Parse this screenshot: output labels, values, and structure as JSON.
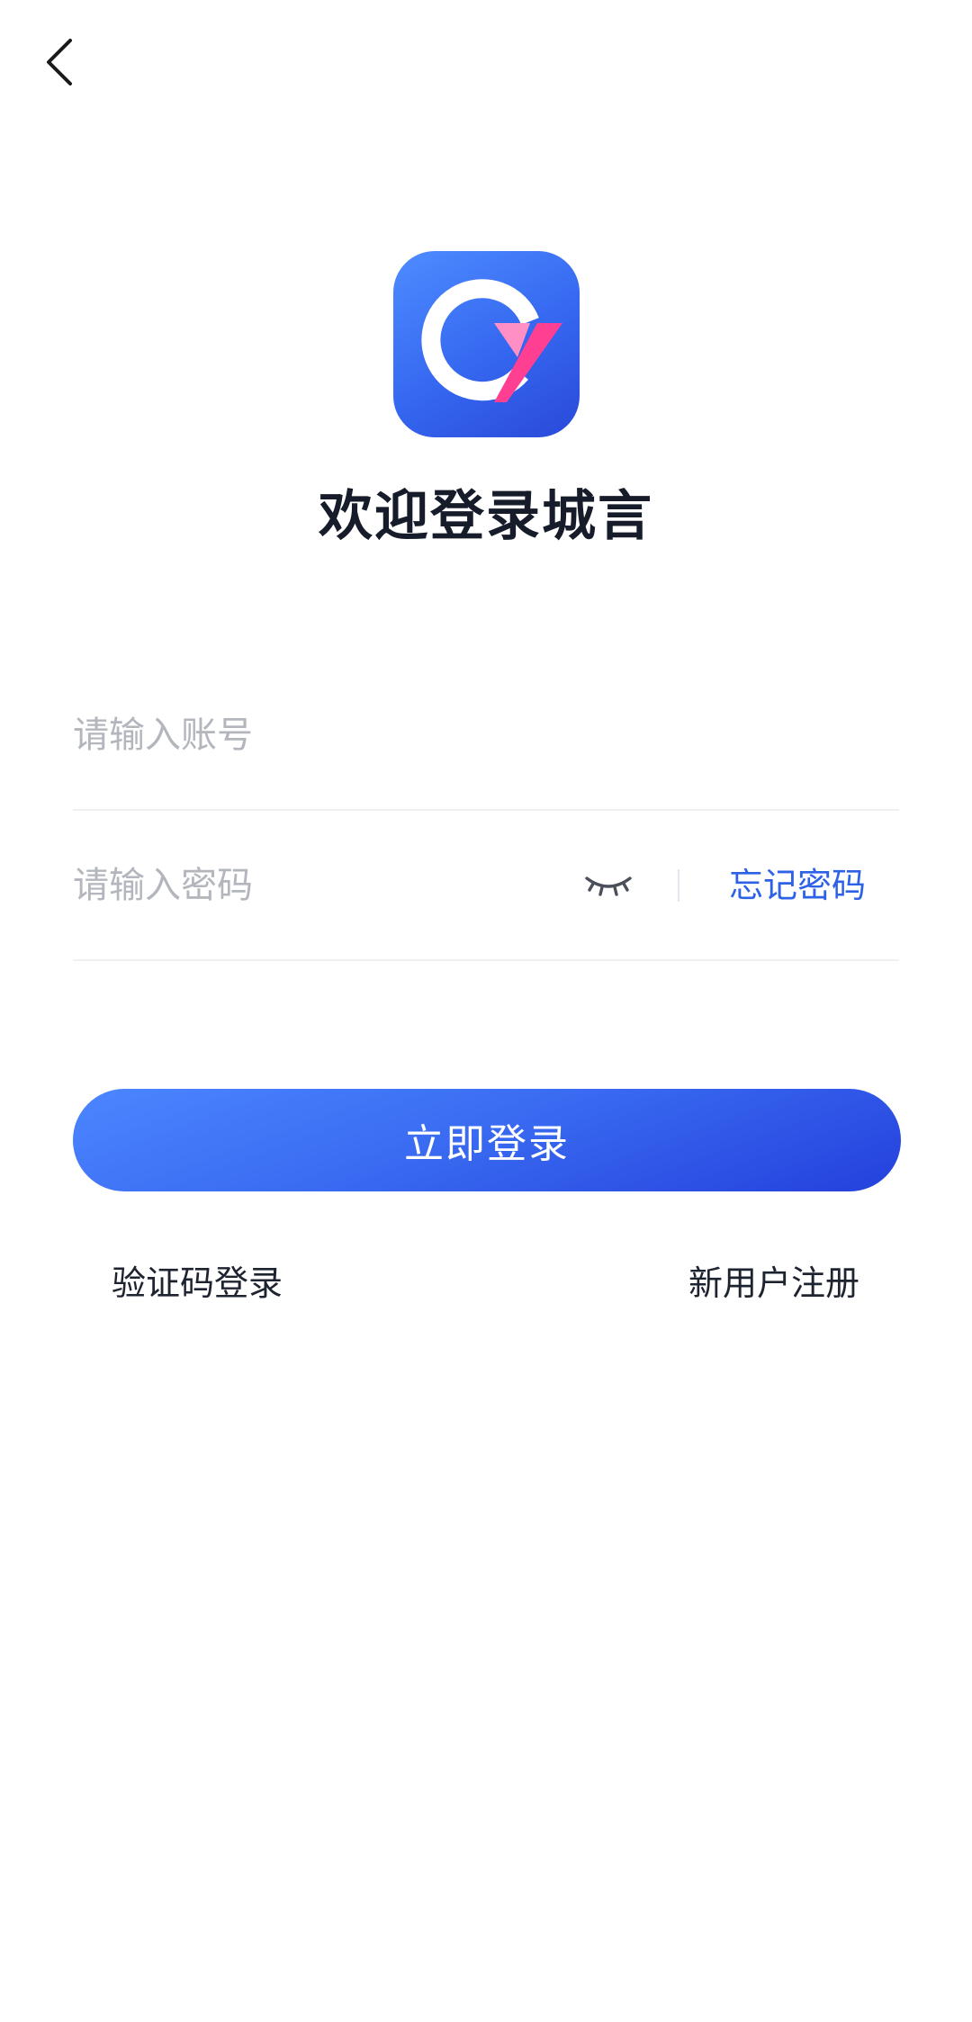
{
  "header": {
    "back_icon": "chevron-left-icon"
  },
  "logo": {
    "icon": "app-logo-icon",
    "colors": {
      "background": "#3567f0",
      "ring": "#ffffff",
      "accent_pink": "#ff4fa0"
    }
  },
  "title": "欢迎登录城言",
  "form": {
    "account": {
      "placeholder": "请输入账号",
      "value": ""
    },
    "password": {
      "placeholder": "请输入密码",
      "value": "",
      "toggle_icon": "eye-closed-icon",
      "forgot_label": "忘记密码"
    }
  },
  "actions": {
    "login_label": "立即登录",
    "sms_login_label": "验证码登录",
    "register_label": "新用户注册"
  },
  "colors": {
    "accent": "#2e62e6",
    "button_start": "#4c86ff",
    "button_end": "#2440dc",
    "placeholder": "#b3b6bd",
    "divider": "#eef0f4",
    "title": "#161c2a"
  }
}
